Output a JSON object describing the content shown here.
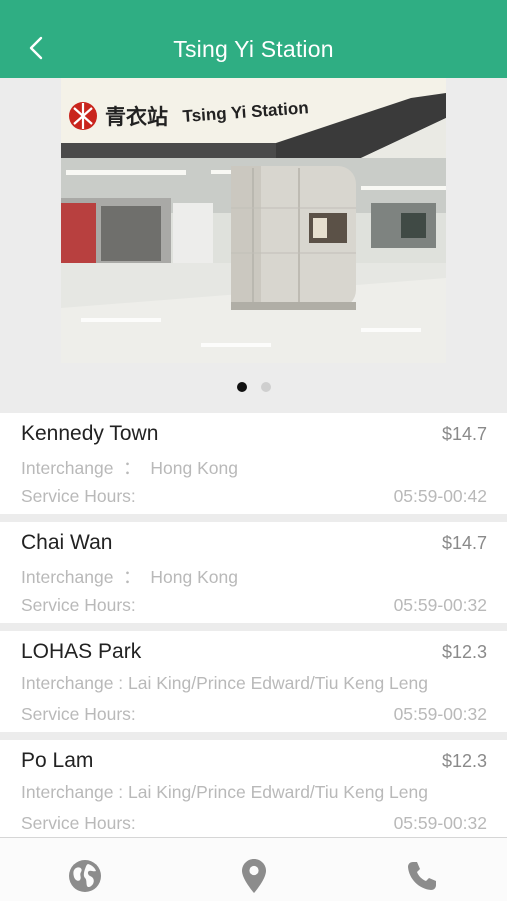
{
  "header": {
    "title": "Tsing Yi Station",
    "back_icon": "chevron-left-icon"
  },
  "carousel": {
    "photo_sign_text": "Tsing Yi Station",
    "photo_sign_chinese": "青衣站",
    "page_count": 2,
    "active_page": 1
  },
  "stations": [
    {
      "name": "Kennedy Town",
      "price": "$14.7",
      "interchange": "Interchange  ：  Hong Kong",
      "hours_label": "Service Hours:",
      "hours": "05:59-00:42"
    },
    {
      "name": "Chai Wan",
      "price": "$14.7",
      "interchange": "Interchange  ：  Hong Kong",
      "hours_label": "Service Hours:",
      "hours": "05:59-00:32"
    },
    {
      "name": "LOHAS Park",
      "price": "$12.3",
      "interchange": "Interchange : Lai King/Prince Edward/Tiu Keng Leng",
      "hours_label": "Service Hours:",
      "hours": "05:59-00:32"
    },
    {
      "name": "Po Lam",
      "price": "$12.3",
      "interchange": "Interchange : Lai King/Prince Edward/Tiu Keng Leng",
      "hours_label": "Service Hours:",
      "hours": "05:59-00:32"
    }
  ],
  "tabbar": {
    "tabs": [
      {
        "icon": "globe-icon"
      },
      {
        "icon": "map-pin-icon"
      },
      {
        "icon": "phone-icon"
      }
    ]
  },
  "colors": {
    "header_bg": "#2fae83",
    "header_text": "#ffffff",
    "icon_gray": "#8c8c8c"
  }
}
